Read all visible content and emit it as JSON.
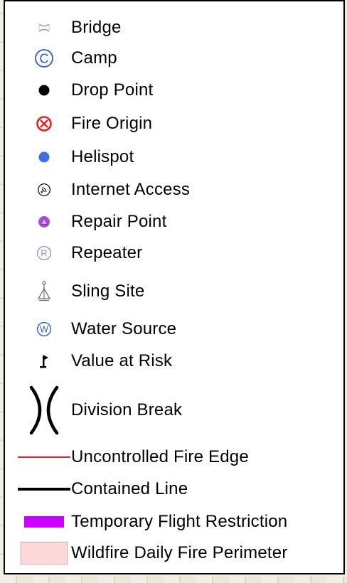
{
  "legend": {
    "items": [
      {
        "label": "Bridge",
        "icon": "bridge-icon",
        "color": "#9a9a9a"
      },
      {
        "label": "Camp",
        "icon": "camp-icon",
        "color": "#2a5bd7"
      },
      {
        "label": "Drop Point",
        "icon": "drop-point-icon",
        "color": "#000000"
      },
      {
        "label": "Fire Origin",
        "icon": "fire-origin-icon",
        "color": "#e8211f"
      },
      {
        "label": "Helispot",
        "icon": "helispot-icon",
        "color": "#3e6fe0"
      },
      {
        "label": "Internet Access",
        "icon": "internet-access-icon",
        "color": "#000000"
      },
      {
        "label": "Repair Point",
        "icon": "repair-point-icon",
        "color": "#a44fd6"
      },
      {
        "label": "Repeater",
        "icon": "repeater-icon",
        "color": "#8a94cf"
      },
      {
        "label": "Sling Site",
        "icon": "sling-site-icon",
        "color": "#666666"
      },
      {
        "label": "Water Source",
        "icon": "water-source-icon",
        "color": "#2a5bd7"
      },
      {
        "label": "Value at Risk",
        "icon": "value-at-risk-icon",
        "color": "#000000"
      },
      {
        "label": "Division Break",
        "icon": "division-break-icon",
        "color": "#000000"
      },
      {
        "label": "Uncontrolled Fire Edge",
        "icon": "uncontrolled-fire-edge-line-icon",
        "color": "#e8211f"
      },
      {
        "label": "Contained Line",
        "icon": "contained-line-icon",
        "color": "#000000"
      },
      {
        "label": "Temporary Flight Restriction",
        "icon": "temporary-flight-restriction-swatch-icon",
        "color": "#c700ff"
      },
      {
        "label": "Wildfire Daily Fire Perimeter",
        "icon": "wildfire-daily-fire-perimeter-swatch-icon",
        "color": "#fdd9d9"
      }
    ]
  }
}
